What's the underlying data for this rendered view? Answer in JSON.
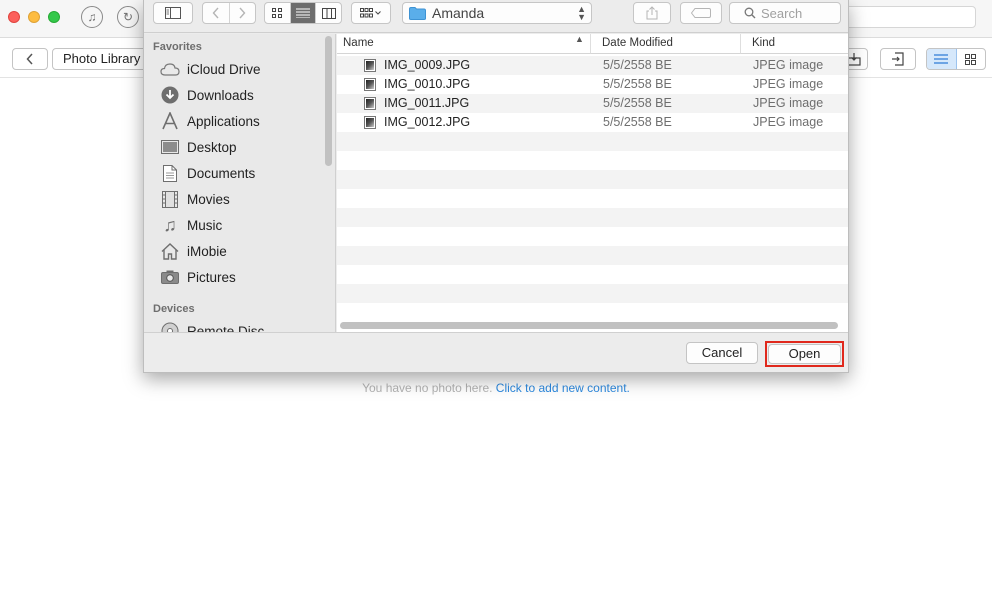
{
  "app": {
    "breadcrumb": "Photo Library",
    "empty_message": "You have no photo here.",
    "add_content_link": "Click to add new content."
  },
  "dialog": {
    "location": "Amanda",
    "search_placeholder": "Search",
    "cancel_label": "Cancel",
    "open_label": "Open",
    "sidebar": {
      "favorites_header": "Favorites",
      "devices_header": "Devices",
      "favorites": [
        {
          "label": "iCloud Drive",
          "icon": "cloud-icon"
        },
        {
          "label": "Downloads",
          "icon": "downloads-icon"
        },
        {
          "label": "Applications",
          "icon": "applications-icon"
        },
        {
          "label": "Desktop",
          "icon": "desktop-icon"
        },
        {
          "label": "Documents",
          "icon": "documents-icon"
        },
        {
          "label": "Movies",
          "icon": "movies-icon"
        },
        {
          "label": "Music",
          "icon": "music-icon"
        },
        {
          "label": "iMobie",
          "icon": "home-icon"
        },
        {
          "label": "Pictures",
          "icon": "camera-icon"
        }
      ],
      "devices": [
        {
          "label": "Remote Disc",
          "icon": "disc-icon"
        }
      ]
    },
    "columns": {
      "name": "Name",
      "date": "Date Modified",
      "kind": "Kind"
    },
    "files": [
      {
        "name": "IMG_0009.JPG",
        "date": "5/5/2558 BE",
        "kind": "JPEG image"
      },
      {
        "name": "IMG_0010.JPG",
        "date": "5/5/2558 BE",
        "kind": "JPEG image"
      },
      {
        "name": "IMG_0011.JPG",
        "date": "5/5/2558 BE",
        "kind": "JPEG image"
      },
      {
        "name": "IMG_0012.JPG",
        "date": "5/5/2558 BE",
        "kind": "JPEG image"
      }
    ]
  },
  "colors": {
    "highlight": "#e0281c",
    "link": "#2d8ae0",
    "folder": "#5aaeea"
  }
}
